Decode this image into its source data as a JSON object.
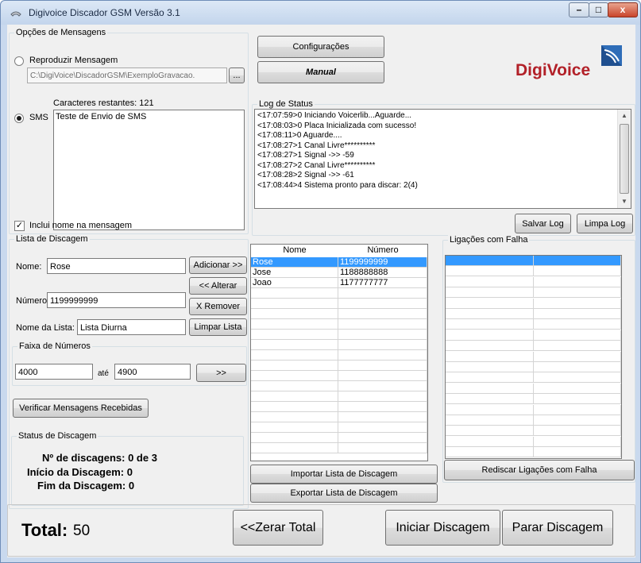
{
  "window": {
    "title": "Digivoice Discador GSM Versão 3.1",
    "minimize_glyph": "–",
    "maximize_glyph": "□",
    "close_glyph": "x"
  },
  "messages": {
    "group_label": "Opções de Mensagens",
    "play_message_label": "Reproduzir Mensagem",
    "file_path": "C:\\DigiVoice\\DiscadorGSM\\ExemploGravacao.",
    "browse_label": "...",
    "remaining_chars": "Caracteres restantes: 121",
    "sms_label": "SMS",
    "sms_text": "Teste de Envio de SMS",
    "include_name_label": "Inclui nome na mensagem",
    "check_mark": "✓"
  },
  "toolbar": {
    "config_label": "Configurações",
    "manual_label": "Manual"
  },
  "logo": {
    "text": "DigiVoice",
    "brand_color": "#b22028"
  },
  "log": {
    "group_label": "Log de Status",
    "lines": [
      "<17:07:59>0 Iniciando Voicerlib...Aguarde...",
      "<17:08:03>0 Placa Inicializada com sucesso!",
      "<17:08:11>0 Aguarde....",
      "<17:08:27>1 Canal Livre**********",
      "<17:08:27>1 Signal ->> -59",
      "<17:08:27>2 Canal Livre**********",
      "<17:08:28>2 Signal ->> -61",
      "<17:08:44>4 Sistema pronto para discar: 2(4)"
    ],
    "save_label": "Salvar Log",
    "clear_label": "Limpa Log"
  },
  "dial_list": {
    "group_label": "Lista de Discagem",
    "name_label": "Nome:",
    "name_value": "Rose",
    "number_label": "Número:",
    "number_value": "1199999999",
    "list_name_label": "Nome da Lista:",
    "list_name_value": "Lista Diurna",
    "add_label": "Adicionar >>",
    "edit_label": "<< Alterar",
    "remove_label": "X Remover",
    "clear_label": "Limpar Lista",
    "range_label": "Faixa de Números",
    "range_from": "4000",
    "range_to_label": "até",
    "range_to": "4900",
    "range_go_label": ">>",
    "check_messages_label": "Verificar Mensagens Recebidas"
  },
  "contacts": {
    "headers": [
      "Nome",
      "Número"
    ],
    "rows": [
      [
        "Rose",
        "1199999999"
      ],
      [
        "Jose",
        "1188888888"
      ],
      [
        "Joao",
        "1177777777"
      ]
    ],
    "import_label": "Importar Lista de Discagem",
    "export_label": "Exportar Lista de Discagem"
  },
  "failures": {
    "group_label": "Ligações com Falha",
    "redial_label": "Rediscar Ligações com Falha"
  },
  "status": {
    "group_label": "Status de Discagem",
    "count_label": "Nº de discagens:",
    "count_value": "0 de 3",
    "start_label": "Início da Discagem:",
    "start_value": "0",
    "end_label": "Fim da Discagem:",
    "end_value": "0"
  },
  "footer": {
    "total_label": "Total:",
    "total_value": "50",
    "reset_label": "<<Zerar Total",
    "start_label": "Iniciar Discagem",
    "stop_label": "Parar Discagem"
  }
}
